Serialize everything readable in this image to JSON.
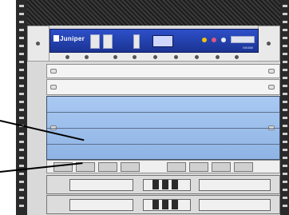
{
  "chassis": {
    "brand_text": "Juniper",
    "model_text": "MX480"
  },
  "colors": {
    "craft_panel": "#2d4fc8",
    "fpc_slot": "#a9c9f2",
    "led_amber": "#f0c400",
    "led_red": "#e2557e",
    "callout": "#000000"
  },
  "icons": [
    "juniper-logo-icon",
    "alarm-led-icon"
  ]
}
